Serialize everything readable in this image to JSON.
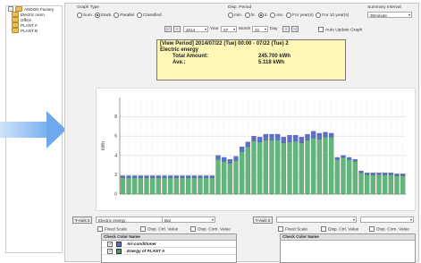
{
  "tree": {
    "items": [
      "ANDON Factory",
      "Electric room",
      "Office",
      "PLANT A",
      "PLANT B"
    ]
  },
  "graph_type": {
    "label": "Graph Type",
    "options": [
      "Sum",
      "Stack",
      "Parallel",
      "Classified"
    ],
    "selected": "Stack"
  },
  "disp_period": {
    "label": "Disp. Period",
    "options": [
      "min.",
      "hr.",
      "d.",
      "mo.",
      "For year(s)",
      "For 10 year(s)"
    ],
    "selected": "d."
  },
  "summary_interval": {
    "label": "Summary Interval",
    "value": "30minute"
  },
  "date_nav": {
    "prev_prev": "|<",
    "prev": "<",
    "year_value": "2014",
    "year_label": "Year",
    "month_value": "07",
    "month_label": "Month",
    "day_value": "22",
    "day_label": "Day",
    "next": ">",
    "next_next": ">|",
    "auto_update": "Auto Update Graph"
  },
  "info_box": {
    "line1": "[View Period] 2014/07/22 (Tue) 00:00 -  07/22 (Tue) 2",
    "line2": "Electric energy",
    "total_label": "Total Amount:",
    "total_value": "245.700  kWh",
    "avg_label": "Ave.:",
    "avg_value": "5.118  kWh"
  },
  "chart_data": {
    "type": "bar",
    "ylabel": "kWh",
    "ylim": [
      0,
      10
    ],
    "yticks": [
      0,
      2,
      4,
      6,
      8
    ],
    "series": [
      {
        "name": "Air-conditioner",
        "color": "#5d6fc6",
        "values": [
          0.2,
          0.2,
          0.2,
          0.2,
          0.2,
          0.2,
          0.2,
          0.2,
          0.2,
          0.2,
          0.2,
          0.2,
          0.2,
          0.2,
          0.2,
          0.2,
          0.4,
          0.4,
          0.4,
          0.4,
          0.5,
          0.5,
          0.5,
          0.5,
          0.6,
          0.6,
          0.6,
          0.6,
          0.7,
          0.6,
          0.6,
          0.6,
          0.7,
          0.6,
          0.5,
          0.4,
          0.2,
          0.2,
          0.2,
          0.2,
          0.2,
          0.2,
          0.2,
          0.2,
          0.2,
          0.2,
          0.2,
          0.2
        ]
      },
      {
        "name": "Energy of PLANT A",
        "color": "#64b57c",
        "values": [
          1.7,
          1.7,
          1.7,
          1.7,
          1.7,
          1.7,
          1.7,
          1.7,
          1.7,
          1.7,
          1.7,
          1.7,
          1.7,
          1.7,
          1.7,
          1.7,
          3.6,
          3.4,
          3.2,
          3.5,
          4.4,
          4.9,
          5.5,
          5.4,
          5.6,
          5.6,
          5.6,
          5.3,
          5.4,
          5.5,
          5.3,
          5.6,
          5.8,
          5.7,
          5.9,
          5.9,
          3.6,
          3.8,
          3.6,
          3.4,
          2.2,
          2.0,
          2.0,
          2.0,
          2.0,
          2.0,
          1.9,
          1.9
        ]
      }
    ]
  },
  "bottom": {
    "y_axis1_button": "Y-Axis 1",
    "y_axis2_button": "Y-Axis 2",
    "select_item": "Electric energy",
    "select_graph": "Bar",
    "fixed_scale": "Fixed Scale",
    "disp_ctrl_value": "Disp. Ctrl. Value",
    "disp_com_value": "Disp. Com. Value",
    "list_header": "Check  Color  Name",
    "list_rows": [
      {
        "name": "Air-conditioner",
        "color": "#5d6fc6"
      },
      {
        "name": "Energy of PLANT A",
        "color": "#4e9a5e"
      }
    ]
  }
}
